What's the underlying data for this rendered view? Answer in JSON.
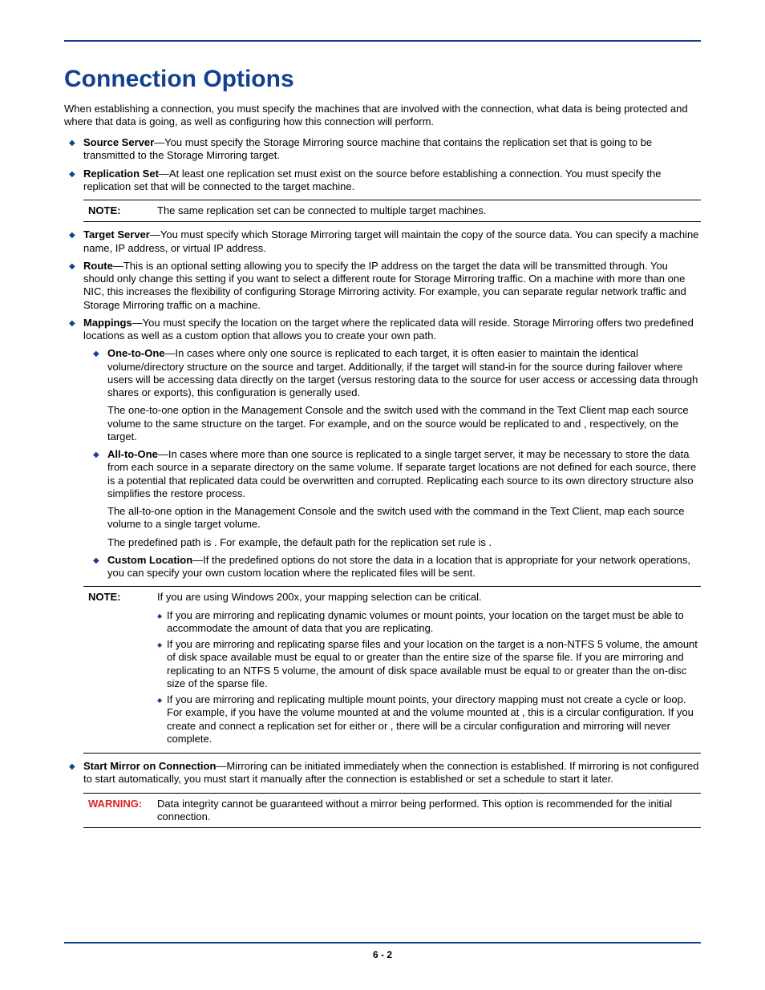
{
  "title": "Connection Options",
  "intro": "When establishing a connection, you must specify the machines that are involved with the connection, what data is being protected and where that data is going, as well as configuring how this connection will perform.",
  "items": {
    "source_server": {
      "label": "Source Server",
      "text": "—You must specify the Storage Mirroring source machine that contains the replication set that is going to be transmitted to the Storage Mirroring target."
    },
    "replication_set": {
      "label": "Replication Set",
      "text": "—At least one replication set must exist on the source before establishing a connection. You must specify the replication set that will be connected to the target machine."
    },
    "target_server": {
      "label": "Target Server",
      "text": "—You must specify which Storage Mirroring target will maintain the copy of the source data. You can specify a machine name, IP address, or virtual IP address."
    },
    "route": {
      "label": "Route",
      "text": "—This is an optional setting allowing you to specify the IP address on the target the data will be transmitted through. You should only change this setting if you want to select a different route for Storage Mirroring traffic. On a machine with more than one NIC, this increases the flexibility of configuring Storage Mirroring activity. For example, you can separate regular network traffic and Storage Mirroring traffic on a machine."
    },
    "mappings": {
      "label": "Mappings",
      "text": "—You must specify the location on the target where the replicated data will reside. Storage Mirroring offers two predefined locations as well as a custom option that allows you to create your own path.",
      "one_to_one": {
        "label": "One-to-One",
        "text": "—In cases where only one source is replicated to each target, it is often easier to maintain the identical volume/directory structure on the source and target. Additionally, if the target will stand-in for the source during failover where users will be accessing data directly on the target (versus restoring data to the source for user access or accessing data through shares or exports), this configuration is generally used.",
        "p2": "The one-to-one option in the Management Console and the               switch used with the               command in the Text Client map each source volume to the same structure on the target. For example,            and            on the source would be replicated to               and            , respectively, on the target."
      },
      "all_to_one": {
        "label": "All-to-One",
        "text": "—In cases where more than one source is replicated to a single target server, it may be necessary to store the data from each source in a separate directory on the same volume. If separate target locations are not defined for each source, there is a potential that replicated data could be overwritten and corrupted. Replicating each source to its own directory structure also simplifies the restore process.",
        "p2": "The all-to-one option in the Management Console and the                  switch used with the               command in the Text Client, map each source volume to a single target volume.",
        "p3": "The predefined path is                                                                                          . For example, the default path for the replication set rule               is                                                                                       ."
      },
      "custom": {
        "label": "Custom Location",
        "text": "—If the predefined options do not store the data in a location that is appropriate for your network operations, you can specify your own custom location where the replicated files will be sent."
      }
    },
    "start_mirror": {
      "label": "Start Mirror on Connection",
      "text": "—Mirroring can be initiated immediately when the connection is established. If mirroring is not configured to start automatically, you must start it manually after the connection is established or set a schedule to start it later."
    }
  },
  "notes": {
    "note1_label": "NOTE:",
    "note1_text": "The same replication set can be connected to multiple target machines.",
    "note2_label": "NOTE:",
    "note2_intro": "If you are using Windows 200x, your mapping selection can be critical.",
    "note2_b1": "If you are mirroring and replicating dynamic volumes or mount points, your location on the target must be able to accommodate the amount of data that you are replicating.",
    "note2_b2": "If you are mirroring and replicating sparse files and your location on the target is a non-NTFS 5 volume, the amount of disk space available must be equal to or greater than the entire size of the sparse file. If you are mirroring and replicating to an NTFS 5 volume, the amount of disk space available must be equal to or greater than the on-disc size of the sparse file.",
    "note2_b3": "If you are mirroring and replicating multiple mount points, your directory mapping must not create a cycle or loop. For example, if you have the        volume mounted at            and the        volume mounted at        , this is a circular configuration. If you create and connect a replication set for either           or        , there will be a circular configuration and mirroring will never complete.",
    "warn_label": "WARNING:",
    "warn_text": "Data integrity cannot be guaranteed without a mirror being performed. This option is recommended for the initial connection."
  },
  "page_number": "6 - 2"
}
